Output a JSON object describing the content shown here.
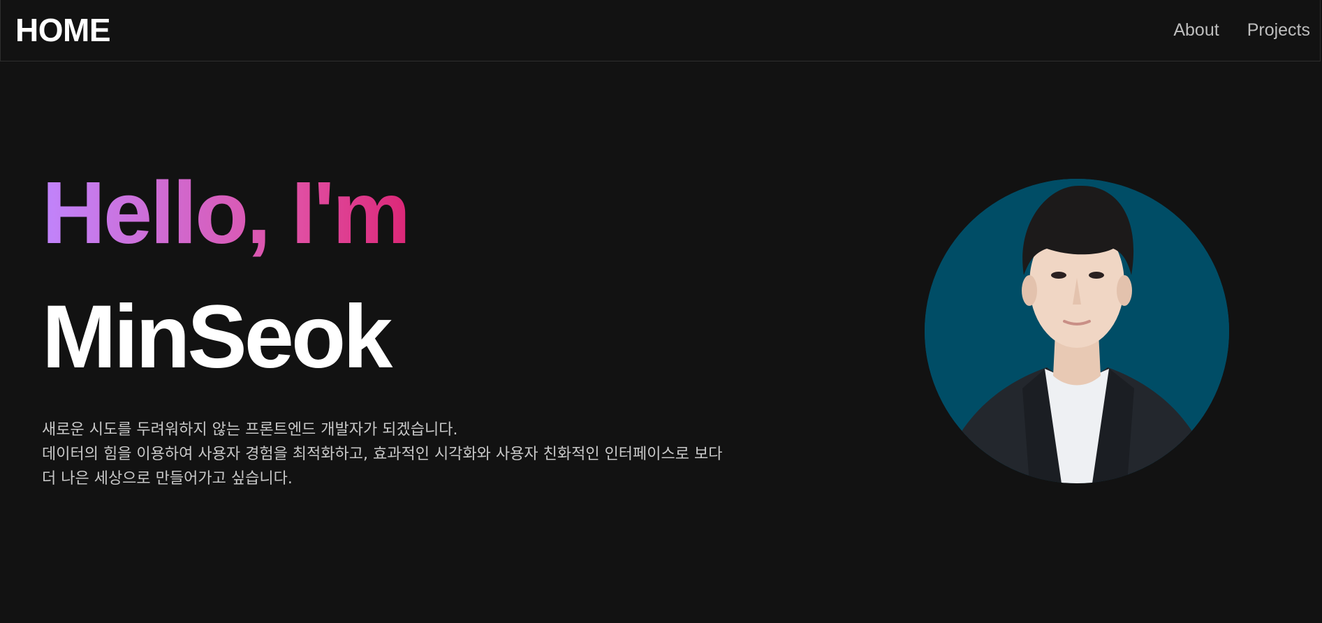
{
  "nav": {
    "brand": "HOME",
    "links": [
      {
        "label": "About"
      },
      {
        "label": "Projects"
      }
    ]
  },
  "hero": {
    "greeting": "Hello, I'm",
    "name": "MinSeok",
    "intro": [
      "새로운 시도를 두려워하지 않는 프론트엔드 개발자가 되겠습니다.",
      "데이터의 힘을 이용하여 사용자 경험을 최적화하고, 효과적인 시각화와 사용자 친화적인 인터페이스로 보다",
      "더 나은 세상으로 만들어가고 싶습니다."
    ]
  },
  "colors": {
    "background": "#121212",
    "gradient_start": "#c084fc",
    "gradient_end": "#db2777",
    "photo_background": "#004d66"
  },
  "icons": {
    "avatar": "profile-photo"
  }
}
